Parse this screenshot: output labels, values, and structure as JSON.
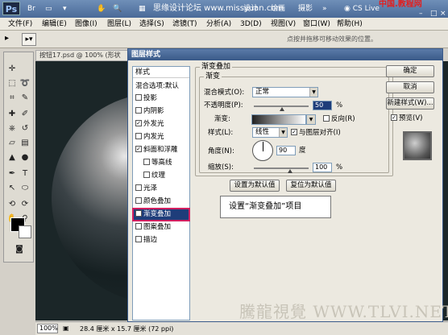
{
  "app": {
    "logo": "Ps",
    "title_watermark": "思缘设计论坛 www.missyuan.com",
    "top_right_watermark": "中国.教程网",
    "cs_live": "CS Live",
    "titlebar_tabs": [
      "设计",
      "绘画",
      "摄影"
    ]
  },
  "menu": [
    "文件(F)",
    "编辑(E)",
    "图像(I)",
    "图层(L)",
    "选择(S)",
    "滤镜(T)",
    "分析(A)",
    "3D(D)",
    "视图(V)",
    "窗口(W)",
    "帮助(H)"
  ],
  "options_bar": {
    "hint": "点按并拖移可移动效果的位置。"
  },
  "document": {
    "tab_title": "按钮17.psd @ 100% (形状",
    "zoom": "100%",
    "doc_info": "28.4 厘米 x 15.7 厘米 (72 ppi)"
  },
  "dialog": {
    "title": "图层样式",
    "styles_header": "样式",
    "styles": [
      {
        "label": "混合选项:默认",
        "checkbox": false,
        "checked": false
      },
      {
        "label": "投影",
        "checkbox": true,
        "checked": false
      },
      {
        "label": "内阴影",
        "checkbox": true,
        "checked": false
      },
      {
        "label": "外发光",
        "checkbox": true,
        "checked": true
      },
      {
        "label": "内发光",
        "checkbox": true,
        "checked": false
      },
      {
        "label": "斜面和浮雕",
        "checkbox": true,
        "checked": true
      },
      {
        "label": "等高线",
        "checkbox": true,
        "checked": false
      },
      {
        "label": "纹理",
        "checkbox": true,
        "checked": false
      },
      {
        "label": "光泽",
        "checkbox": true,
        "checked": false
      },
      {
        "label": "颜色叠加",
        "checkbox": true,
        "checked": false
      },
      {
        "label": "渐变叠加",
        "checkbox": true,
        "checked": true
      },
      {
        "label": "图案叠加",
        "checkbox": true,
        "checked": false
      },
      {
        "label": "描边",
        "checkbox": true,
        "checked": false
      }
    ],
    "section_title": "渐变叠加",
    "group_title": "渐变",
    "blend_mode_label": "混合模式(O):",
    "blend_mode_value": "正常",
    "opacity_label": "不透明度(P):",
    "opacity_value": "50",
    "opacity_unit": "%",
    "gradient_label": "渐变:",
    "reverse_label": "反向(R)",
    "style_label": "样式(L):",
    "style_value": "线性",
    "align_label": "与图层对齐(I)",
    "angle_label": "角度(N):",
    "angle_value": "90",
    "angle_unit": "度",
    "scale_label": "缩放(S):",
    "scale_value": "100",
    "scale_unit": "%",
    "set_default_btn": "设置为默认值",
    "reset_default_btn": "复位为默认值",
    "ok_btn": "确定",
    "cancel_btn": "取消",
    "new_style_btn": "新建样式(W)...",
    "preview_label": "预览(V)",
    "preview_checked": true
  },
  "callout": "设置“渐变叠加”项目",
  "bottom_watermark": "騰龍視覺 WWW.TLVI.NET"
}
